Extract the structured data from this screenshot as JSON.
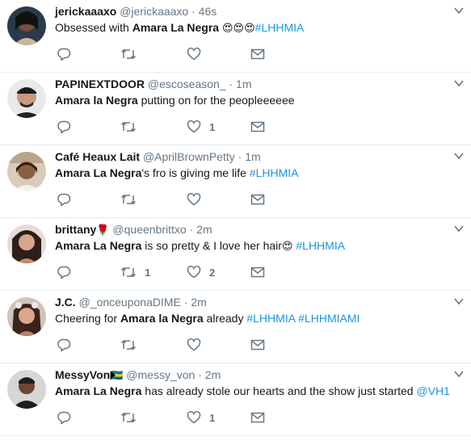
{
  "tweets": [
    {
      "fullname": "jerickaaaxo",
      "handle": "@jerickaaaxo",
      "time": "46s",
      "text_name": "",
      "text_bold": "Amara La Negra",
      "text_pre": "Obsessed with ",
      "text_post": " ",
      "emoji": "😍😍😍",
      "hashtags": "#LHHMIA",
      "mention": "",
      "reply_count": "",
      "retweet_count": "",
      "like_count": "",
      "avatar_color": "#3a2a26"
    },
    {
      "fullname": "PAPINEXTDOOR",
      "handle": "@escoseason_",
      "time": "1m",
      "text_pre": "",
      "text_bold": "Amara la Negra",
      "text_post": " putting on for the peopleeeeee",
      "emoji": "",
      "hashtags": "",
      "mention": "",
      "reply_count": "",
      "retweet_count": "",
      "like_count": "1",
      "avatar_color": "#2b2b2b"
    },
    {
      "fullname": "Café Heaux Lait",
      "handle": "@AprilBrownPetty",
      "time": "1m",
      "text_pre": "",
      "text_bold": "Amara La Negra",
      "text_post": "'s fro is giving me life ",
      "emoji": "",
      "hashtags": "#LHHMIA",
      "mention": "",
      "reply_count": "",
      "retweet_count": "",
      "like_count": "",
      "avatar_color": "#8a6a52"
    },
    {
      "fullname": "brittany",
      "name_emoji": "🌹",
      "handle": "@queenbrittxo",
      "time": "2m",
      "text_pre": "",
      "text_bold": "Amara La Negra",
      "text_post": " is so pretty & I love her hair",
      "emoji": "😍",
      "hashtags": " #LHHMIA",
      "mention": "",
      "reply_count": "",
      "retweet_count": "1",
      "like_count": "2",
      "avatar_color": "#b07a66"
    },
    {
      "fullname": "J.C.",
      "handle": "@_onceuponaDIME",
      "time": "2m",
      "text_pre": "Cheering for ",
      "text_bold": "Amara la Negra",
      "text_post": " already ",
      "emoji": "",
      "hashtags": "#LHHMIA #LHHMIAMI",
      "mention": "",
      "reply_count": "",
      "retweet_count": "",
      "like_count": "",
      "avatar_color": "#6e4a3c"
    },
    {
      "fullname": "MessyVon",
      "name_emoji": "🇧🇸",
      "handle": "@messy_von",
      "time": "2m",
      "text_pre": "",
      "text_bold": "Amara La Negra",
      "text_post": " has already stole our hearts and the show just started ",
      "emoji": "",
      "hashtags": "",
      "mention": "@VH1",
      "reply_count": "",
      "retweet_count": "",
      "like_count": "1",
      "avatar_color": "#3d3d3d"
    }
  ],
  "colors": {
    "link": "#1b95e0",
    "muted": "#657786",
    "icon": "#657786",
    "divider": "#e6ecf0"
  },
  "icons": [
    "reply-icon",
    "retweet-icon",
    "like-icon",
    "direct-message-icon",
    "caret-down-icon"
  ]
}
